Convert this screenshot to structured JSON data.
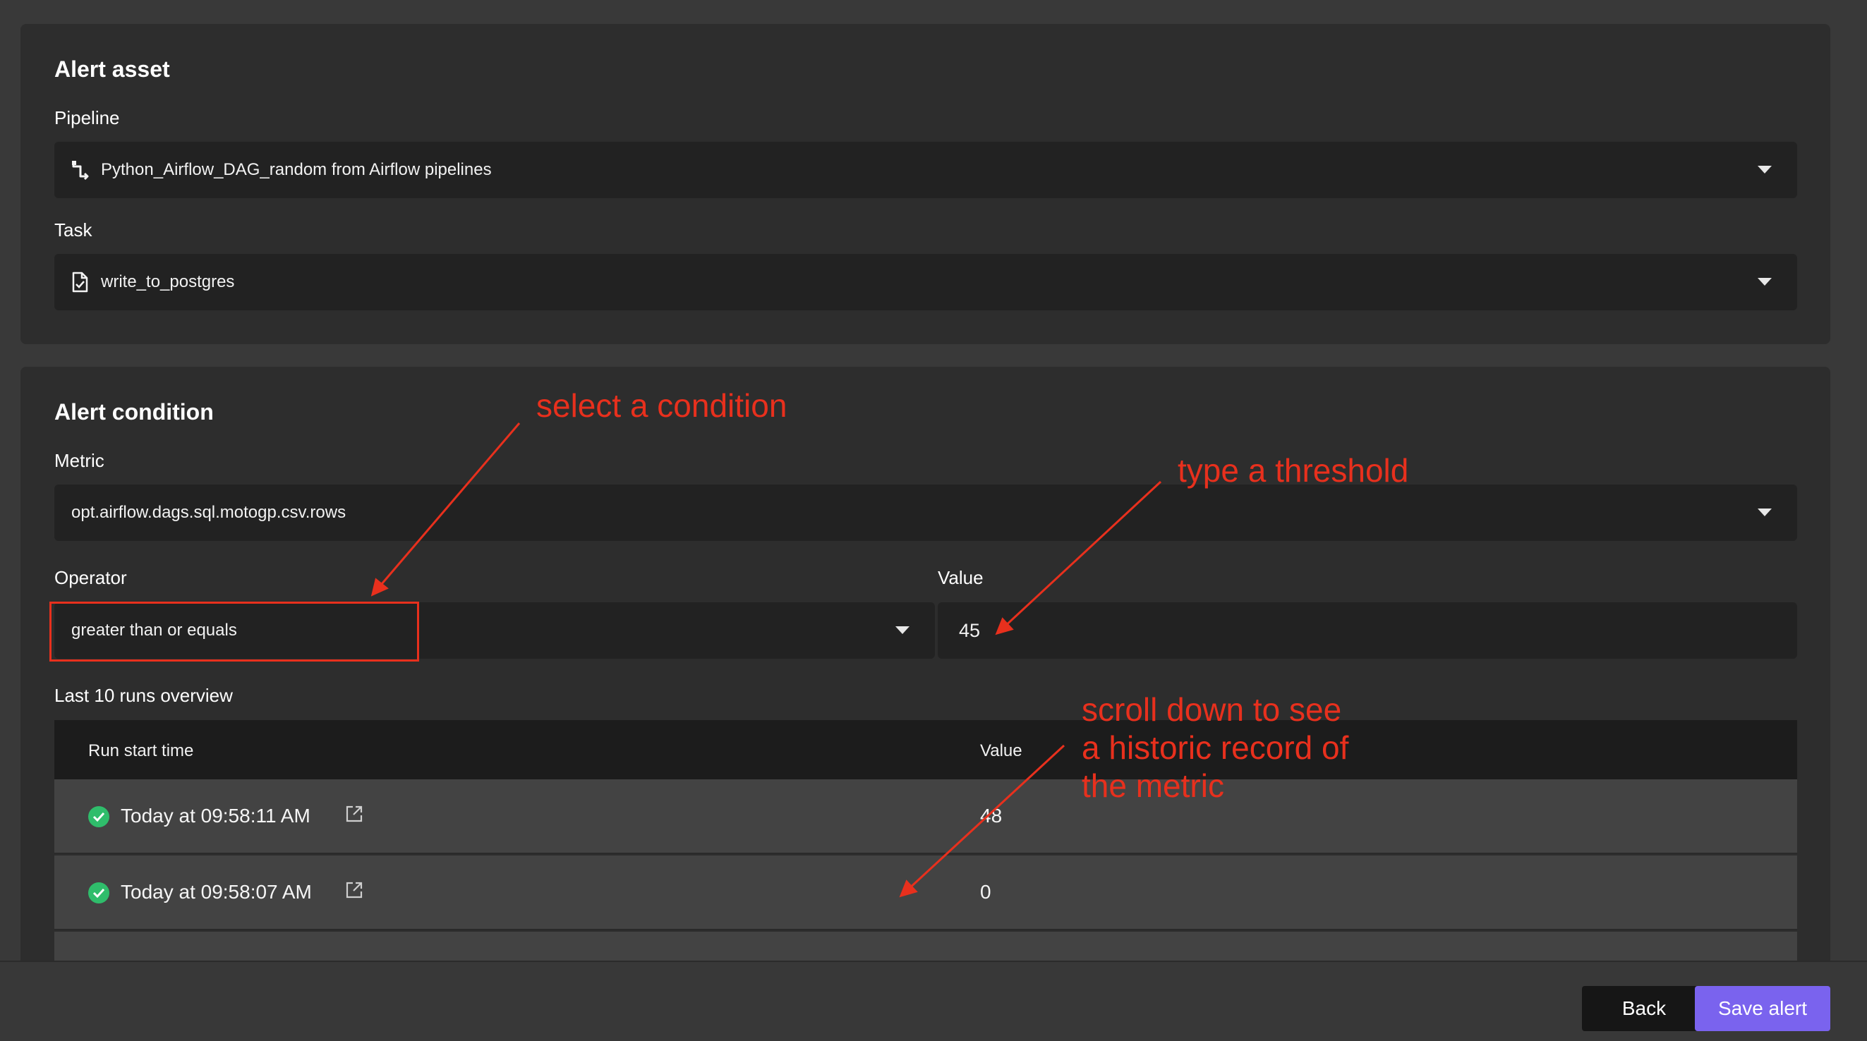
{
  "alert_asset": {
    "title": "Alert asset",
    "pipeline_label": "Pipeline",
    "pipeline_value": "Python_Airflow_DAG_random from Airflow pipelines",
    "pipeline_icon": "pipeline-icon",
    "task_label": "Task",
    "task_value": "write_to_postgres",
    "task_icon": "task-file-check-icon"
  },
  "alert_condition": {
    "title": "Alert condition",
    "metric_label": "Metric",
    "metric_value": "opt.airflow.dags.sql.motogp.csv.rows",
    "operator_label": "Operator",
    "operator_value": "greater than or equals",
    "value_label": "Value",
    "value_value": "45",
    "runs_label": "Last 10 runs overview",
    "table": {
      "headers": [
        "Run start time",
        "Value"
      ],
      "rows": [
        {
          "run_start_time": "Today at 09:58:11 AM",
          "value": "48",
          "status": "success"
        },
        {
          "run_start_time": "Today at 09:58:07 AM",
          "value": "0",
          "status": "success"
        }
      ]
    }
  },
  "footer": {
    "back_label": "Back",
    "save_label": "Save alert"
  },
  "annotations": {
    "select_condition": "select a condition",
    "type_threshold": "type a threshold",
    "scroll_line1": "scroll down to see",
    "scroll_line2": "a historic record of",
    "scroll_line3": "the metric",
    "color": "#e8301d"
  },
  "colors": {
    "accent": "#7a63ee",
    "success": "#2fbd6b",
    "annotation": "#e8301d"
  }
}
